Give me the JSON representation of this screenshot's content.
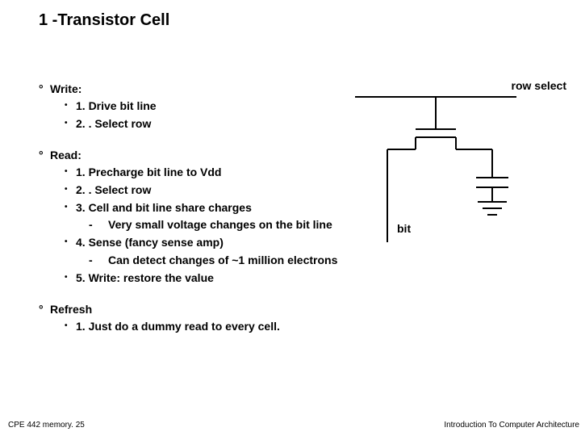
{
  "title": "1 -Transistor Cell",
  "labels": {
    "rowSelect": "row select",
    "bit": "bit"
  },
  "write": {
    "heading": "Write:",
    "items": [
      "1. Drive bit line",
      "2. . Select row"
    ]
  },
  "read": {
    "heading": "Read:",
    "items": [
      "1. Precharge bit line to Vdd",
      "2. . Select row",
      "3. Cell and bit line share charges",
      "4. Sense (fancy sense amp)",
      "5. Write: restore the value"
    ],
    "sub3": "Very small voltage changes on the bit line",
    "sub4": "Can detect changes of ~1 million  electrons"
  },
  "refresh": {
    "heading": "Refresh",
    "items": [
      "1. Just do a dummy read to every cell."
    ]
  },
  "footer": {
    "left": "CPE 442 memory. 25",
    "right": "Introduction To Computer Architecture"
  }
}
